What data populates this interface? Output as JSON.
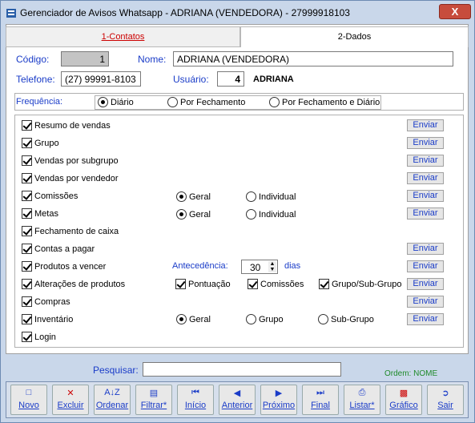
{
  "window": {
    "title": "Gerenciador de Avisos Whatsapp - ADRIANA (VENDEDORA) - 27999918103",
    "close_label": "X"
  },
  "tabs": [
    {
      "label": "1-Contatos"
    },
    {
      "label": "2-Dados"
    }
  ],
  "form": {
    "codigo_label": "Código:",
    "codigo_value": "1",
    "nome_label": "Nome:",
    "nome_value": "ADRIANA (VENDEDORA)",
    "telefone_label": "Telefone:",
    "telefone_value": "(27) 99991-8103",
    "usuario_label": "Usuário:",
    "usuario_value": "4",
    "usuario_name": "ADRIANA"
  },
  "frequencia": {
    "label": "Frequência:",
    "options": [
      "Diário",
      "Por Fechamento",
      "Por Fechamento e Diário"
    ],
    "selected": "Diário"
  },
  "options": {
    "resumo": "Resumo de vendas",
    "grupo": "Grupo",
    "subgrupo": "Vendas por subgrupo",
    "vendedor": "Vendas por vendedor",
    "comissoes": "Comissões",
    "metas": "Metas",
    "fechamento": "Fechamento de caixa",
    "contas": "Contas a pagar",
    "produtos": "Produtos a vencer",
    "alteracoes": "Alterações de produtos",
    "compras": "Compras",
    "inventario": "Inventário",
    "login": "Login",
    "geral": "Geral",
    "individual": "Individual",
    "antecedencia_label": "Antecedência:",
    "antecedencia_value": "30",
    "dias": "dias",
    "pontuacao": "Pontuação",
    "comissoes_chk": "Comissões",
    "grupo_sub": "Grupo/Sub-Grupo",
    "subgrupo_radio": "Sub-Grupo",
    "enviar": "Enviar"
  },
  "search": {
    "label": "Pesquisar:",
    "value": "",
    "ordem": "Ordem: NOME"
  },
  "toolbar": [
    "Novo",
    "Excluir",
    "Ordenar",
    "Filtrar*",
    "Início",
    "Anterior",
    "Próximo",
    "Final",
    "Listar*",
    "Gráfico",
    "Sair"
  ],
  "colors": {
    "accent": "#1a3cc8",
    "ordem": "#1f8a2a",
    "tab_active_text": "#cc0000"
  }
}
